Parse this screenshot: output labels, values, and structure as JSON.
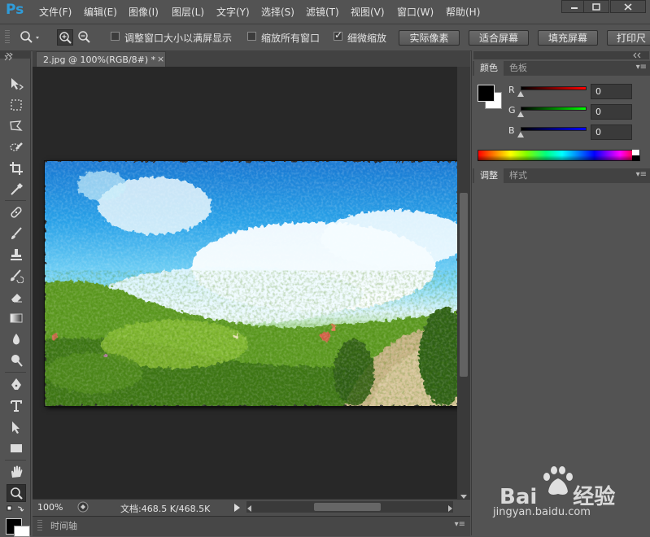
{
  "app": {
    "logo": "Ps"
  },
  "menu": [
    "文件(F)",
    "编辑(E)",
    "图像(I)",
    "图层(L)",
    "文字(Y)",
    "选择(S)",
    "滤镜(T)",
    "视图(V)",
    "窗口(W)",
    "帮助(H)"
  ],
  "window_controls": {
    "minimize_icon": "minimize-icon",
    "maximize_icon": "restore-icon",
    "close_icon": "close-icon"
  },
  "options": {
    "resize_windows": {
      "label": "调整窗口大小以满屏显示",
      "checked": false
    },
    "zoom_all": {
      "label": "缩放所有窗口",
      "checked": false
    },
    "scrubby_zoom": {
      "label": "细微缩放",
      "checked": true
    },
    "buttons": [
      "实际像素",
      "适合屏幕",
      "填充屏幕",
      "打印尺"
    ]
  },
  "document": {
    "tab_title": "2.jpg @ 100%(RGB/8#) *",
    "close_glyph": "×"
  },
  "status": {
    "zoom": "100%",
    "doc_size": "文档:468.5 K/468.5K"
  },
  "timeline": {
    "label": "时间轴"
  },
  "color_panel": {
    "tabs": [
      "颜色",
      "色板"
    ],
    "channels": [
      {
        "label": "R",
        "value": "0",
        "color": "#d42020"
      },
      {
        "label": "G",
        "value": "0",
        "color": "#20b020"
      },
      {
        "label": "B",
        "value": "0",
        "color": "#2020d0"
      }
    ],
    "foreground": "#000000",
    "background": "#ffffff"
  },
  "adjust_panel": {
    "tabs": [
      "调整",
      "样式"
    ]
  },
  "watermark": {
    "brand": "Bai",
    "brand_suffix": "经验",
    "url": "jingyan.baidu.com"
  },
  "colors": {
    "ui_bg": "#535353",
    "canvas_bg": "#282828",
    "accent": "#2f9cd9"
  }
}
